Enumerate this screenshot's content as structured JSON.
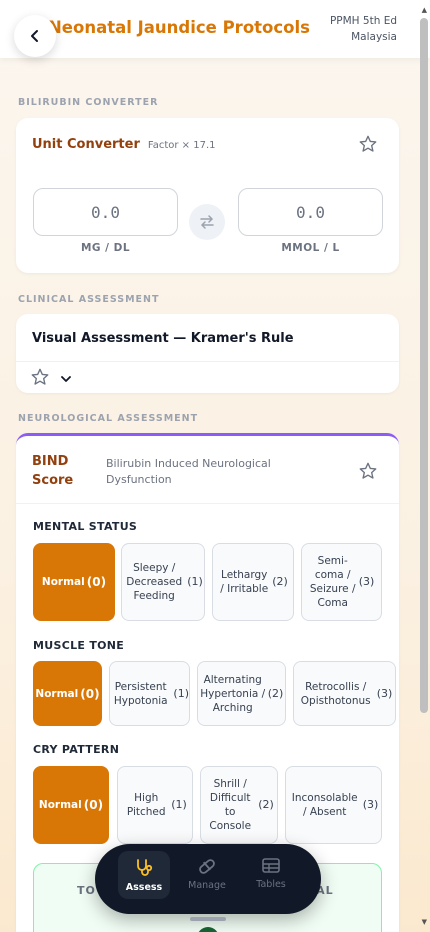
{
  "header": {
    "title": "Neonatal Jaundice Protocols",
    "edition_line1": "PPMH 5th Ed",
    "edition_line2": "Malaysia"
  },
  "sections": {
    "bilirubin": "BILIRUBIN CONVERTER",
    "clinical": "CLINICAL ASSESSMENT",
    "neuro": "NEUROLOGICAL ASSESSMENT"
  },
  "converter": {
    "title": "Unit Converter",
    "factor": "Factor × 17.1",
    "left_value": "0.0",
    "right_value": "0.0",
    "left_unit": "MG / DL",
    "right_unit": "MMOL / L"
  },
  "kramer": {
    "title": "Visual Assessment — Kramer's Rule"
  },
  "bind": {
    "title_line1": "BIND",
    "title_line2": "Score",
    "subtitle_line1": "Bilirubin Induced Neurological",
    "subtitle_line2": "Dysfunction",
    "mental": {
      "heading": "MENTAL STATUS",
      "options": [
        {
          "label": "Normal",
          "points": "(0)"
        },
        {
          "label": "Sleepy / Decreased Feeding",
          "points": "(1)"
        },
        {
          "label": "Lethargy / Irritable",
          "points": "(2)"
        },
        {
          "label": "Semi-coma / Seizure / Coma",
          "points": "(3)"
        }
      ]
    },
    "muscle": {
      "heading": "MUSCLE TONE",
      "options": [
        {
          "label": "Normal",
          "points": "(0)"
        },
        {
          "label": "Persistent Hypotonia",
          "points": "(1)"
        },
        {
          "label": "Alternating Hypertonia / Arching",
          "points": "(2)"
        },
        {
          "label": "Retrocollis / Opisthotonus",
          "points": "(3)"
        }
      ]
    },
    "cry": {
      "heading": "CRY PATTERN",
      "options": [
        {
          "label": "Normal",
          "points": "(0)"
        },
        {
          "label": "High Pitched",
          "points": "(1)"
        },
        {
          "label": "Shrill / Difficult to Console",
          "points": "(2)"
        },
        {
          "label": "Inconsolable / Absent",
          "points": "(3)"
        }
      ]
    },
    "result_left": "TOT",
    "result_right": "CAL"
  },
  "nav": {
    "items": [
      {
        "label": "Assess",
        "icon": "stethoscope-icon"
      },
      {
        "label": "Manage",
        "icon": "pill-icon"
      },
      {
        "label": "Tables",
        "icon": "table-icon"
      }
    ]
  },
  "colors": {
    "accent": "#d97706",
    "bind_border": "#8b5cf6",
    "nav_bg": "#111827"
  }
}
